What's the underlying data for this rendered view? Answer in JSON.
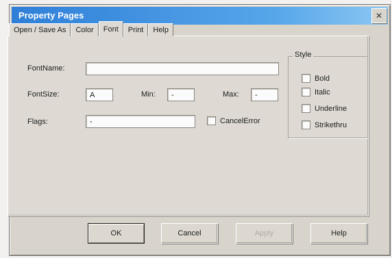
{
  "window": {
    "title": "Property Pages",
    "close_glyph": "✕"
  },
  "tabs": [
    {
      "label": "Open / Save As"
    },
    {
      "label": "Color"
    },
    {
      "label": "Font",
      "active": true
    },
    {
      "label": "Print"
    },
    {
      "label": "Help"
    }
  ],
  "font_page": {
    "font_name_label": "FontName:",
    "font_name_value": "",
    "font_size_label": "FontSize:",
    "font_size_value": "A",
    "min_label": "Min:",
    "min_value": "-",
    "max_label": "Max:",
    "max_value": "-",
    "flags_label": "Flags:",
    "flags_value": "-",
    "cancel_error_label": "CancelError",
    "cancel_error_checked": false
  },
  "style_group": {
    "title": "Style",
    "items": [
      {
        "label": "Bold",
        "checked": false
      },
      {
        "label": "Italic",
        "checked": false
      },
      {
        "label": "Underline",
        "checked": false
      },
      {
        "label": "Strikethru",
        "checked": false
      }
    ]
  },
  "buttons": {
    "ok": "OK",
    "cancel": "Cancel",
    "apply": "Apply",
    "help": "Help"
  }
}
